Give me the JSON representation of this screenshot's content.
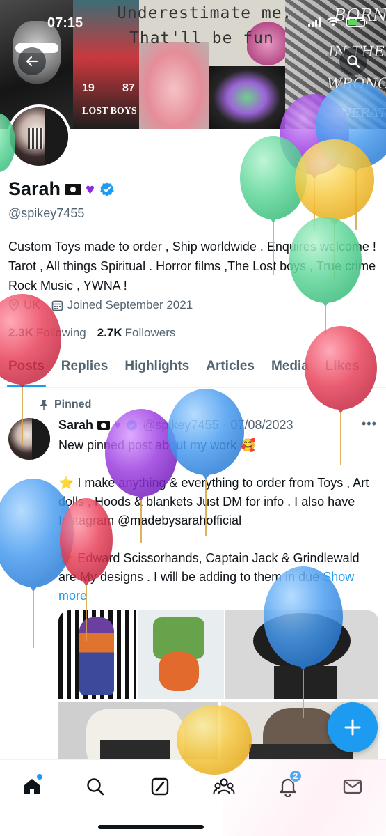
{
  "status_bar": {
    "time": "07:15"
  },
  "banner": {
    "line1": "Underestimate me.",
    "line2": "That'll be fun",
    "lost_boys": "LOST BOYS",
    "year_left": "19",
    "year_right": "87",
    "right_text": [
      "BORN",
      "IN THE",
      "WRONG",
      "GENERATION"
    ]
  },
  "profile": {
    "name": "Sarah",
    "handle": "@spikey7455",
    "bio": "Custom Toys made to order , Ship worldwide . Enquires welcome ! Tarot , All things Spiritual . Horror films ,The Lost boys , True crime Rock Music , YWNA !",
    "location": "UK",
    "joined": "Joined September 2021",
    "following_count": "2.3K",
    "following_label": "Following",
    "followers_count": "2.7K",
    "followers_label": "Followers"
  },
  "tabs": [
    "Posts",
    "Replies",
    "Highlights",
    "Articles",
    "Media",
    "Likes"
  ],
  "post": {
    "pinned_label": "Pinned",
    "author": "Sarah",
    "handle": "@spikey7455",
    "date": "· 07/08/2023",
    "text": "New pinned post about my work 🥰\n\n⭐ I make anything & everything to order from Toys , Art dolls , Hoods & blankets Just DM for info . I also have Instagram @madebysarahofficial\n\n⭐ Edward Scissorhands, Captain Jack & Grindlewald are My designs . I will be adding to them in due",
    "show_more": "Show more"
  },
  "bottom_nav": {
    "items": [
      "home-icon",
      "search-icon",
      "grok-icon",
      "communities-icon",
      "notifications-icon",
      "messages-icon"
    ],
    "notification_count": "2"
  },
  "colors": {
    "accent": "#1d9bf0",
    "text": "#0f1419",
    "secondary": "#536471",
    "balloon_blue": "#5aa9f5",
    "balloon_green": "#66dba0",
    "balloon_purple": "#a040e0",
    "balloon_yellow": "#f5c842",
    "balloon_red": "#e8425a"
  }
}
